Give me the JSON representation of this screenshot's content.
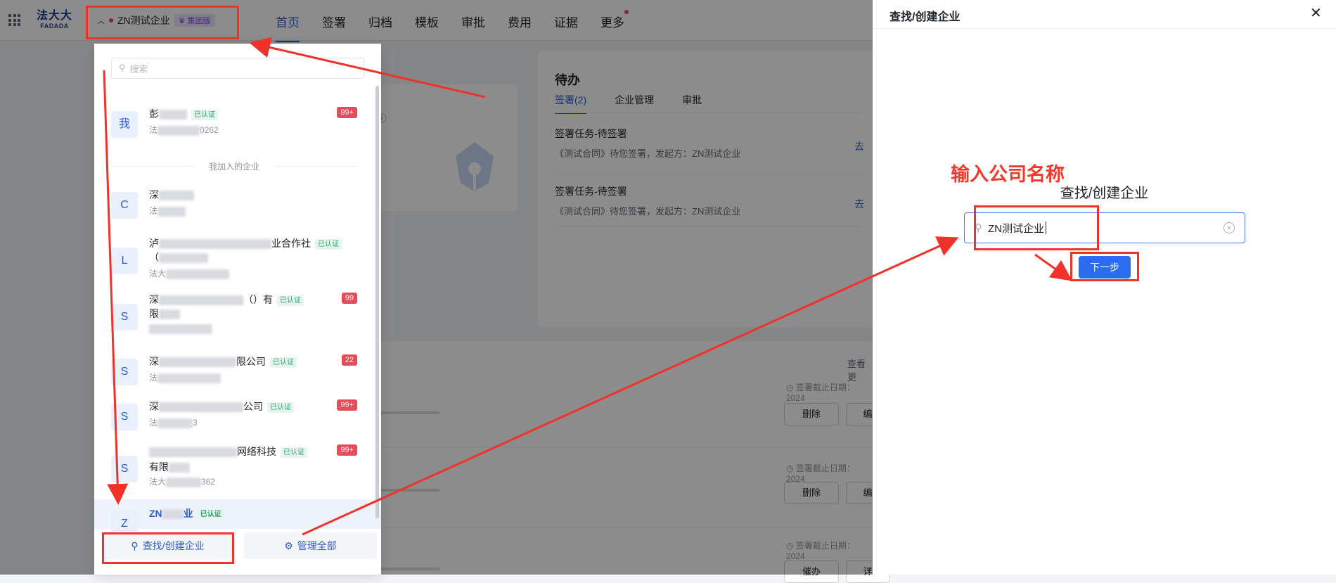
{
  "topbar": {
    "logo_cn": "法大大",
    "logo_en": "FADADA",
    "current_enterprise": "ZN测试企业",
    "edition_badge": "集团版",
    "nav": [
      "首页",
      "签署",
      "归档",
      "模板",
      "审批",
      "费用",
      "证据",
      "更多"
    ]
  },
  "todo": {
    "title": "待办",
    "tabs": [
      "签署(2)",
      "企业管理",
      "审批"
    ],
    "tasks": [
      {
        "title": "签署任务-待签署",
        "sub": "《测试合同》待您签署，发起方：ZN测试企业",
        "action": "去"
      },
      {
        "title": "签署任务-待签署",
        "sub": "《测试合同》待您签署，发起方：ZN测试企业",
        "action": "去"
      }
    ]
  },
  "left_card": {
    "status_text": "中"
  },
  "contracts": {
    "view_more": "查看更",
    "rows": [
      {
        "meta": "签署截止日期：2024",
        "btn1": "删除",
        "btn2": "编"
      },
      {
        "meta": "签署截止日期：2024",
        "btn1": "删除",
        "btn2": "编"
      },
      {
        "meta": "签署截止日期：2024",
        "btn1": "催办",
        "btn2": "详"
      }
    ]
  },
  "dropdown": {
    "search_placeholder": "搜索",
    "divider": "我加入的企业",
    "cert": "已认证",
    "items": [
      {
        "avatar": "我",
        "name_prefix": "彭",
        "name_suffix": "",
        "id_prefix": "法",
        "id_suffix": "0262",
        "count": "99+"
      },
      {
        "avatar": "C",
        "name_prefix": "深",
        "name_suffix": "",
        "id_prefix": "法",
        "id_suffix": "",
        "count": ""
      },
      {
        "avatar": "L",
        "name_prefix": "泸",
        "name_suffix": "业合作社",
        "name_line2": "（",
        "id_prefix": "法大",
        "id_suffix": "",
        "count": ""
      },
      {
        "avatar": "S",
        "name_prefix": "深",
        "name_suffix": "（）有",
        "name_line2": "限",
        "id_prefix": "法",
        "id_suffix": "",
        "count": "99"
      },
      {
        "avatar": "S",
        "name_prefix": "深",
        "name_suffix": "限公司",
        "id_prefix": "法",
        "id_suffix": "",
        "count": "22"
      },
      {
        "avatar": "S",
        "name_prefix": "深",
        "name_suffix": "公司",
        "id_prefix": "法",
        "id_suffix": "3",
        "count": "99+"
      },
      {
        "avatar": "S",
        "name_prefix": "",
        "name_suffix": "网络科技",
        "name_line2": "有限",
        "id_prefix": "法大",
        "id_suffix": "362",
        "count": "99+"
      },
      {
        "avatar": "Z",
        "name_prefix": "ZN",
        "name_suffix": "业",
        "id_prefix": "",
        "id_suffix": "",
        "count": ""
      }
    ],
    "footer_find": "查找/创建企业",
    "footer_manage": "管理全部"
  },
  "drawer": {
    "header": "查找/创建企业",
    "close": "✕",
    "title": "查找/创建企业",
    "input_value": "ZN测试企业",
    "next": "下一步"
  },
  "annotation": {
    "label": "输入公司名称",
    "color": "#f03a2e"
  }
}
